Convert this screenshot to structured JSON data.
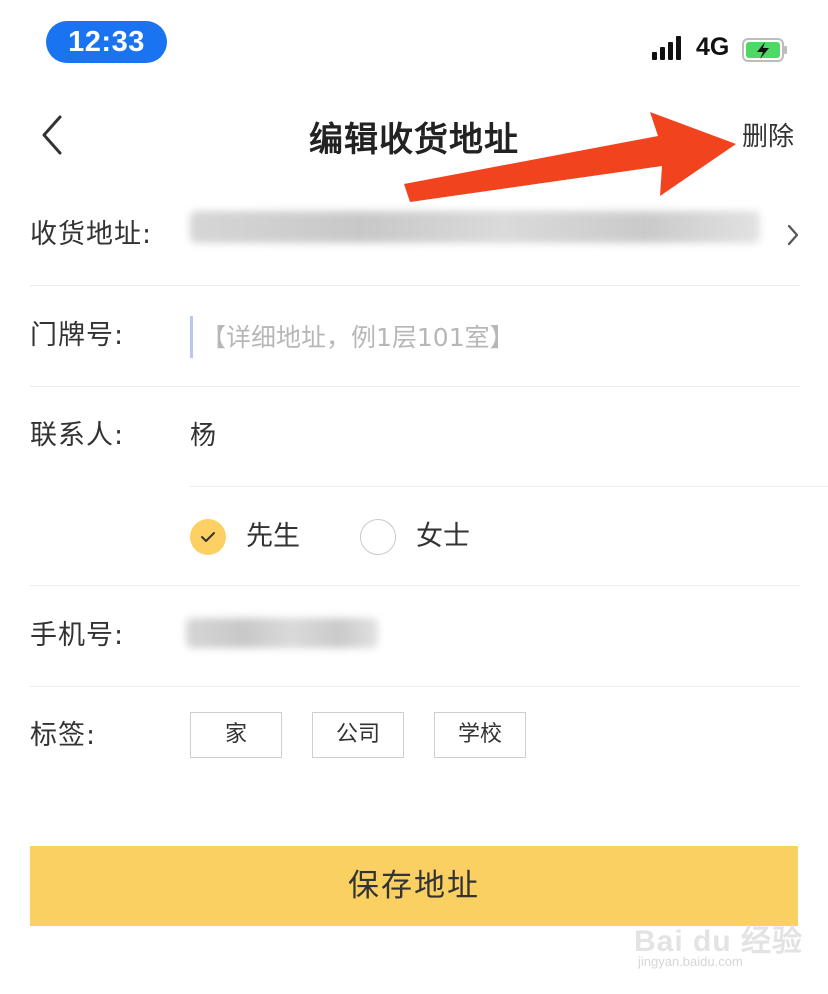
{
  "status_bar": {
    "time": "12:33",
    "network": "4G",
    "time_pill_color": "#1a73f0",
    "battery_color": "#4cd964"
  },
  "nav": {
    "back_icon": "chevron-left-icon",
    "title": "编辑收货地址",
    "delete_label": "删除"
  },
  "form": {
    "address": {
      "label": "收货地址:",
      "value_blurred": true
    },
    "door_number": {
      "label": "门牌号:",
      "placeholder": "【详细地址，例1层101室】",
      "value": ""
    },
    "contact": {
      "label": "联系人:",
      "value": "杨"
    },
    "gender": {
      "options": [
        {
          "label": "先生",
          "selected": true
        },
        {
          "label": "女士",
          "selected": false
        }
      ]
    },
    "phone": {
      "label": "手机号:",
      "value_blurred": true
    },
    "tags": {
      "label": "标签:",
      "options": [
        "家",
        "公司",
        "学校"
      ]
    }
  },
  "save_button": {
    "label": "保存地址",
    "color": "#fbd063"
  },
  "annotation": {
    "arrow_color": "#f2431f",
    "icon": "red-arrow-icon"
  },
  "watermark": {
    "text": "Bai du 经验",
    "subtext": "jingyan.baidu.com"
  }
}
